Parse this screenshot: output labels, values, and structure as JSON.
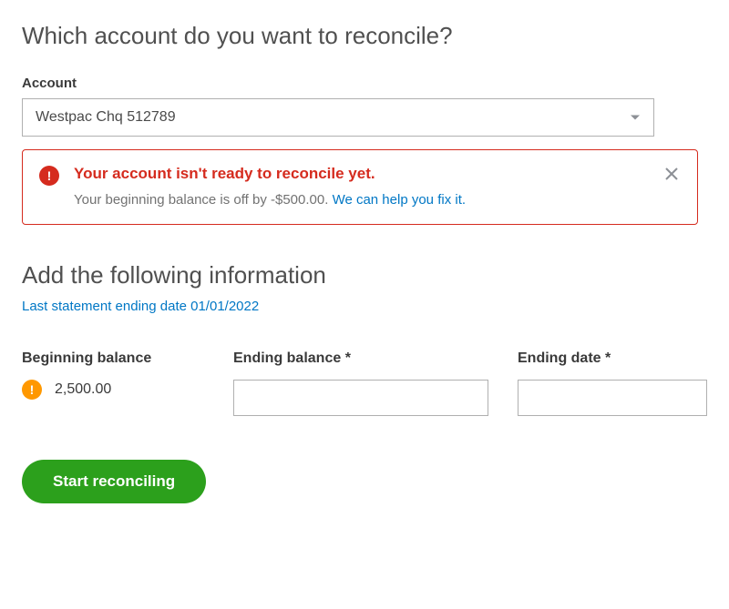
{
  "heading": "Which account do you want to reconcile?",
  "account": {
    "label": "Account",
    "selected": "Westpac Chq 512789"
  },
  "alert": {
    "title": "Your account isn't ready to reconcile yet.",
    "message": "Your beginning balance is off by -$500.00. ",
    "link": "We can help you fix it."
  },
  "section_heading": "Add the following information",
  "last_statement": "Last statement ending date 01/01/2022",
  "fields": {
    "beginning_balance": {
      "label": "Beginning balance",
      "value": "2,500.00"
    },
    "ending_balance": {
      "label": "Ending balance *",
      "value": ""
    },
    "ending_date": {
      "label": "Ending date *",
      "value": ""
    }
  },
  "actions": {
    "start": "Start reconciling"
  }
}
